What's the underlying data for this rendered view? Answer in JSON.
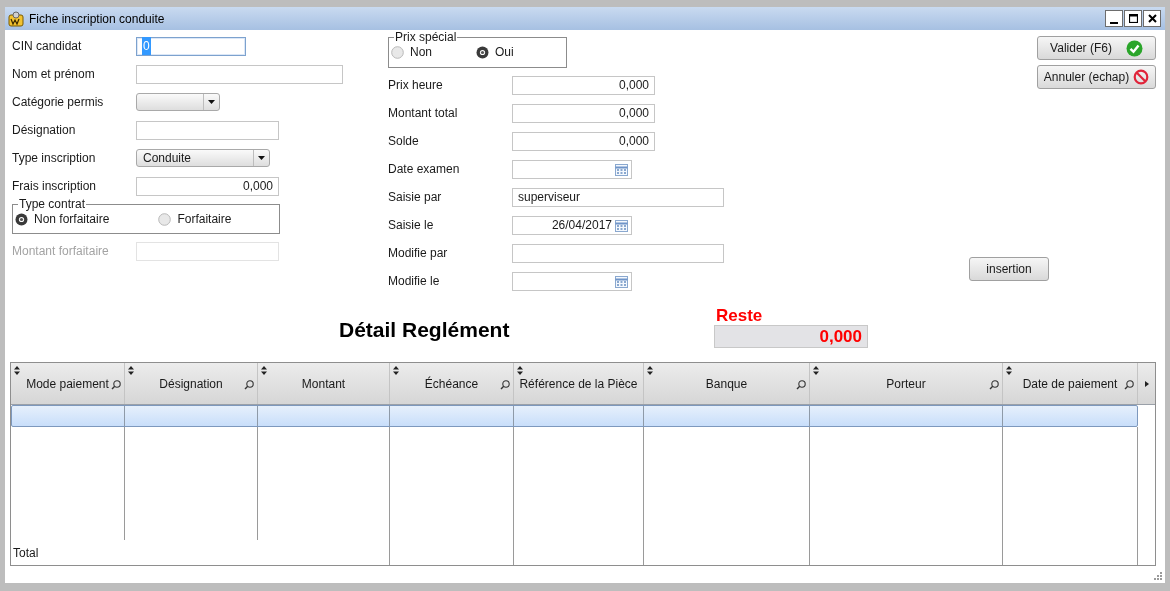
{
  "window": {
    "title": "Fiche inscription conduite"
  },
  "candidate_form": {
    "fields": [
      {
        "kind": "text",
        "label": "CIN candidat",
        "value": "0",
        "focused": true,
        "disabled": false
      },
      {
        "kind": "text",
        "label": "Nom et prénom",
        "focused": false,
        "disabled": false
      },
      {
        "kind": "select",
        "label": "Catégorie permis",
        "focused": false,
        "disabled": false
      },
      {
        "kind": "text",
        "label": "Désignation",
        "focused": false,
        "disabled": false
      },
      {
        "kind": "select",
        "label": "Type inscription",
        "value": "Conduite",
        "focused": false,
        "disabled": false
      },
      {
        "kind": "number",
        "label": "Frais inscription",
        "value": "0,000",
        "focused": false,
        "disabled": false
      }
    ],
    "contract_type": {
      "legend": "Type contrat",
      "options": [
        {
          "label": "Non forfaitaire",
          "selected": true
        },
        {
          "label": "Forfaitaire",
          "selected": false
        }
      ]
    },
    "fields_after": [
      {
        "kind": "text",
        "label": "Montant forfaitaire",
        "focused": false,
        "disabled": true
      }
    ]
  },
  "pricing": {
    "special_price": {
      "legend": "Prix spécial",
      "options": [
        {
          "label": "Non",
          "selected": false
        },
        {
          "label": "Oui",
          "selected": true
        }
      ]
    },
    "fields": [
      {
        "kind": "number",
        "label": "Prix heure",
        "value": "0,000"
      },
      {
        "kind": "number",
        "label": "Montant total",
        "value": "0,000"
      },
      {
        "kind": "number",
        "label": "Solde",
        "value": "0,000"
      },
      {
        "kind": "date",
        "label": "Date examen"
      },
      {
        "kind": "text",
        "label": "Saisie par",
        "value": "superviseur"
      },
      {
        "kind": "date",
        "label": "Saisie le",
        "value": "26/04/2017"
      },
      {
        "kind": "text",
        "label": "Modifie par"
      },
      {
        "kind": "date",
        "label": "Modifie le"
      }
    ]
  },
  "actions": [
    {
      "label": "Valider (F6)"
    },
    {
      "label": "Annuler (echap)"
    }
  ],
  "insert_button": {
    "label": "insertion"
  },
  "payments": {
    "title": "Détail Reglément",
    "remaining": {
      "label": "Reste",
      "value": "0,000"
    },
    "table": {
      "columns": [
        {
          "label": "Mode paiement",
          "filterable": true
        },
        {
          "label": "Désignation",
          "filterable": true
        },
        {
          "label": "Montant",
          "filterable": false
        },
        {
          "label": "Échéance",
          "filterable": true
        },
        {
          "label": "Référence de la Pièce",
          "filterable": false
        },
        {
          "label": "Banque",
          "filterable": true
        },
        {
          "label": "Porteur",
          "filterable": true
        },
        {
          "label": "Date de paiement",
          "filterable": true
        }
      ],
      "rows": [
        {
          "selected": true
        }
      ],
      "total_label": "Total"
    }
  }
}
